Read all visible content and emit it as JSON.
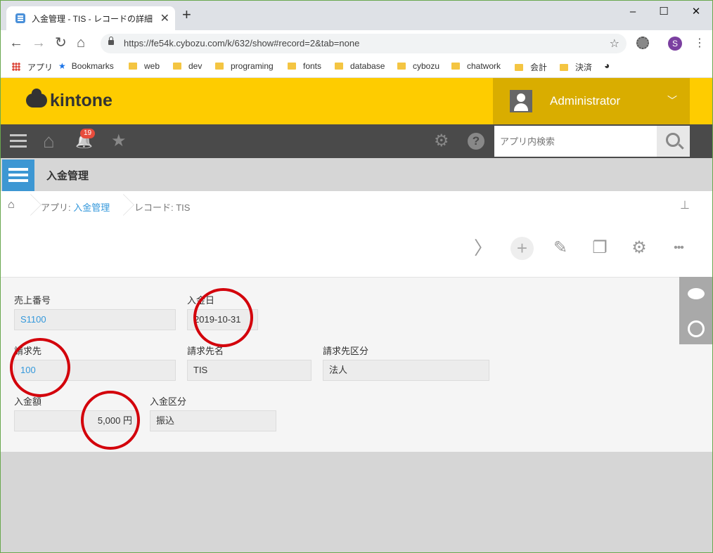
{
  "browser": {
    "tab_title": "入金管理 - TIS - レコードの詳細",
    "tab_close": "✕",
    "new_tab": "+",
    "minimize": "–",
    "maximize": "☐",
    "close": "✕",
    "url": "https://fe54k.cybozu.com/k/632/show#record=2&tab=none",
    "back": "←",
    "forward": "→",
    "reload": "↻",
    "home": "⌂",
    "star": "☆",
    "profile_initial": "S",
    "menu": "⋮"
  },
  "bookmarks": [
    {
      "label": "アプリ",
      "icon": "apps-grid-icon"
    },
    {
      "label": "Bookmarks",
      "icon": "star-icon"
    },
    {
      "label": "web",
      "icon": "folder-icon"
    },
    {
      "label": "dev",
      "icon": "folder-icon"
    },
    {
      "label": "programing",
      "icon": "folder-icon"
    },
    {
      "label": "fonts",
      "icon": "folder-icon"
    },
    {
      "label": "database",
      "icon": "folder-icon"
    },
    {
      "label": "cybozu",
      "icon": "folder-icon"
    },
    {
      "label": "chatwork",
      "icon": "folder-icon"
    },
    {
      "label": "会計",
      "icon": "folder-icon"
    },
    {
      "label": "決済",
      "icon": "folder-icon"
    }
  ],
  "header": {
    "logo": "kintone",
    "user": "Administrator",
    "user_chevron": "﹀",
    "brand_color": "#fecc00"
  },
  "gnav": {
    "home": "⌂",
    "bell": "🔔",
    "notification_count": "19",
    "favorites": "★",
    "settings": "⚙",
    "help": "?",
    "search_placeholder": "アプリ内検索"
  },
  "app": {
    "name": "入金管理"
  },
  "breadcrumb": {
    "app_prefix": "アプリ: ",
    "app_link": "入金管理",
    "record": "レコード: TIS",
    "pin": "📌"
  },
  "actions": {
    "next": "〉",
    "add": "+",
    "edit": "✎",
    "duplicate": "❐",
    "settings": "⚙",
    "more": "•••"
  },
  "fields": {
    "sales_no": {
      "label": "売上番号",
      "value": "S1100"
    },
    "payment_date": {
      "label": "入金日",
      "value": "2019-10-31"
    },
    "billing_to": {
      "label": "請求先",
      "value": "100"
    },
    "billing_name": {
      "label": "請求先名",
      "value": "TIS"
    },
    "billing_type": {
      "label": "請求先区分",
      "value": "法人"
    },
    "amount": {
      "label": "入金額",
      "value": "5,000 円"
    },
    "payment_type": {
      "label": "入金区分",
      "value": "振込"
    }
  },
  "colors": {
    "annotation_ring": "#d3000b",
    "link": "#3498db"
  }
}
